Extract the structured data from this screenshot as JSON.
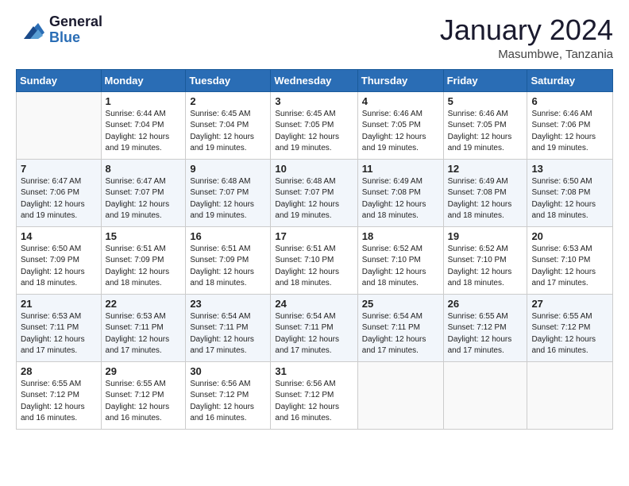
{
  "logo": {
    "general": "General",
    "blue": "Blue"
  },
  "title": "January 2024",
  "location": "Masumbwe, Tanzania",
  "days_header": [
    "Sunday",
    "Monday",
    "Tuesday",
    "Wednesday",
    "Thursday",
    "Friday",
    "Saturday"
  ],
  "weeks": [
    [
      {
        "day": "",
        "sunrise": "",
        "sunset": "",
        "daylight": ""
      },
      {
        "day": "1",
        "sunrise": "Sunrise: 6:44 AM",
        "sunset": "Sunset: 7:04 PM",
        "daylight": "Daylight: 12 hours and 19 minutes."
      },
      {
        "day": "2",
        "sunrise": "Sunrise: 6:45 AM",
        "sunset": "Sunset: 7:04 PM",
        "daylight": "Daylight: 12 hours and 19 minutes."
      },
      {
        "day": "3",
        "sunrise": "Sunrise: 6:45 AM",
        "sunset": "Sunset: 7:05 PM",
        "daylight": "Daylight: 12 hours and 19 minutes."
      },
      {
        "day": "4",
        "sunrise": "Sunrise: 6:46 AM",
        "sunset": "Sunset: 7:05 PM",
        "daylight": "Daylight: 12 hours and 19 minutes."
      },
      {
        "day": "5",
        "sunrise": "Sunrise: 6:46 AM",
        "sunset": "Sunset: 7:05 PM",
        "daylight": "Daylight: 12 hours and 19 minutes."
      },
      {
        "day": "6",
        "sunrise": "Sunrise: 6:46 AM",
        "sunset": "Sunset: 7:06 PM",
        "daylight": "Daylight: 12 hours and 19 minutes."
      }
    ],
    [
      {
        "day": "7",
        "sunrise": "Sunrise: 6:47 AM",
        "sunset": "Sunset: 7:06 PM",
        "daylight": "Daylight: 12 hours and 19 minutes."
      },
      {
        "day": "8",
        "sunrise": "Sunrise: 6:47 AM",
        "sunset": "Sunset: 7:07 PM",
        "daylight": "Daylight: 12 hours and 19 minutes."
      },
      {
        "day": "9",
        "sunrise": "Sunrise: 6:48 AM",
        "sunset": "Sunset: 7:07 PM",
        "daylight": "Daylight: 12 hours and 19 minutes."
      },
      {
        "day": "10",
        "sunrise": "Sunrise: 6:48 AM",
        "sunset": "Sunset: 7:07 PM",
        "daylight": "Daylight: 12 hours and 19 minutes."
      },
      {
        "day": "11",
        "sunrise": "Sunrise: 6:49 AM",
        "sunset": "Sunset: 7:08 PM",
        "daylight": "Daylight: 12 hours and 18 minutes."
      },
      {
        "day": "12",
        "sunrise": "Sunrise: 6:49 AM",
        "sunset": "Sunset: 7:08 PM",
        "daylight": "Daylight: 12 hours and 18 minutes."
      },
      {
        "day": "13",
        "sunrise": "Sunrise: 6:50 AM",
        "sunset": "Sunset: 7:08 PM",
        "daylight": "Daylight: 12 hours and 18 minutes."
      }
    ],
    [
      {
        "day": "14",
        "sunrise": "Sunrise: 6:50 AM",
        "sunset": "Sunset: 7:09 PM",
        "daylight": "Daylight: 12 hours and 18 minutes."
      },
      {
        "day": "15",
        "sunrise": "Sunrise: 6:51 AM",
        "sunset": "Sunset: 7:09 PM",
        "daylight": "Daylight: 12 hours and 18 minutes."
      },
      {
        "day": "16",
        "sunrise": "Sunrise: 6:51 AM",
        "sunset": "Sunset: 7:09 PM",
        "daylight": "Daylight: 12 hours and 18 minutes."
      },
      {
        "day": "17",
        "sunrise": "Sunrise: 6:51 AM",
        "sunset": "Sunset: 7:10 PM",
        "daylight": "Daylight: 12 hours and 18 minutes."
      },
      {
        "day": "18",
        "sunrise": "Sunrise: 6:52 AM",
        "sunset": "Sunset: 7:10 PM",
        "daylight": "Daylight: 12 hours and 18 minutes."
      },
      {
        "day": "19",
        "sunrise": "Sunrise: 6:52 AM",
        "sunset": "Sunset: 7:10 PM",
        "daylight": "Daylight: 12 hours and 18 minutes."
      },
      {
        "day": "20",
        "sunrise": "Sunrise: 6:53 AM",
        "sunset": "Sunset: 7:10 PM",
        "daylight": "Daylight: 12 hours and 17 minutes."
      }
    ],
    [
      {
        "day": "21",
        "sunrise": "Sunrise: 6:53 AM",
        "sunset": "Sunset: 7:11 PM",
        "daylight": "Daylight: 12 hours and 17 minutes."
      },
      {
        "day": "22",
        "sunrise": "Sunrise: 6:53 AM",
        "sunset": "Sunset: 7:11 PM",
        "daylight": "Daylight: 12 hours and 17 minutes."
      },
      {
        "day": "23",
        "sunrise": "Sunrise: 6:54 AM",
        "sunset": "Sunset: 7:11 PM",
        "daylight": "Daylight: 12 hours and 17 minutes."
      },
      {
        "day": "24",
        "sunrise": "Sunrise: 6:54 AM",
        "sunset": "Sunset: 7:11 PM",
        "daylight": "Daylight: 12 hours and 17 minutes."
      },
      {
        "day": "25",
        "sunrise": "Sunrise: 6:54 AM",
        "sunset": "Sunset: 7:11 PM",
        "daylight": "Daylight: 12 hours and 17 minutes."
      },
      {
        "day": "26",
        "sunrise": "Sunrise: 6:55 AM",
        "sunset": "Sunset: 7:12 PM",
        "daylight": "Daylight: 12 hours and 17 minutes."
      },
      {
        "day": "27",
        "sunrise": "Sunrise: 6:55 AM",
        "sunset": "Sunset: 7:12 PM",
        "daylight": "Daylight: 12 hours and 16 minutes."
      }
    ],
    [
      {
        "day": "28",
        "sunrise": "Sunrise: 6:55 AM",
        "sunset": "Sunset: 7:12 PM",
        "daylight": "Daylight: 12 hours and 16 minutes."
      },
      {
        "day": "29",
        "sunrise": "Sunrise: 6:55 AM",
        "sunset": "Sunset: 7:12 PM",
        "daylight": "Daylight: 12 hours and 16 minutes."
      },
      {
        "day": "30",
        "sunrise": "Sunrise: 6:56 AM",
        "sunset": "Sunset: 7:12 PM",
        "daylight": "Daylight: 12 hours and 16 minutes."
      },
      {
        "day": "31",
        "sunrise": "Sunrise: 6:56 AM",
        "sunset": "Sunset: 7:12 PM",
        "daylight": "Daylight: 12 hours and 16 minutes."
      },
      {
        "day": "",
        "sunrise": "",
        "sunset": "",
        "daylight": ""
      },
      {
        "day": "",
        "sunrise": "",
        "sunset": "",
        "daylight": ""
      },
      {
        "day": "",
        "sunrise": "",
        "sunset": "",
        "daylight": ""
      }
    ]
  ]
}
